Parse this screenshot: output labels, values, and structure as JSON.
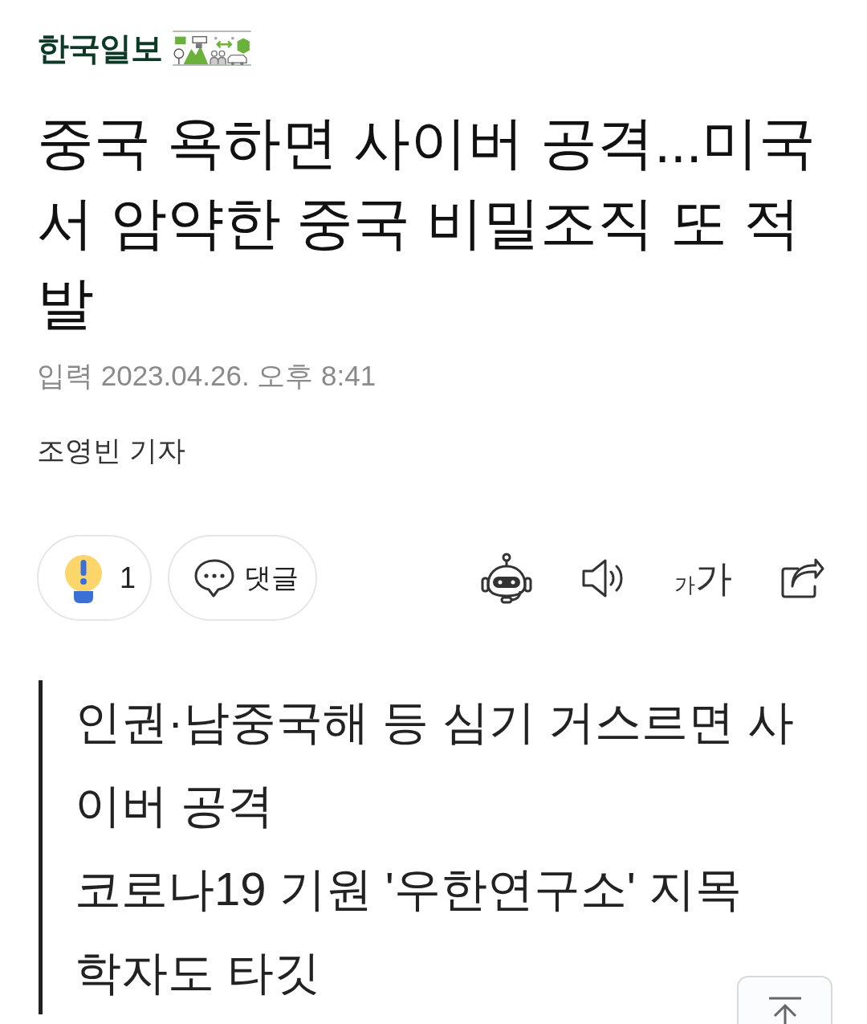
{
  "logo": {
    "text": "한국일보"
  },
  "headline": "중국 욕하면 사이버 공격...미국서 암약한 중국 비밀조직 또 적발",
  "published": "입력 2023.04.26. 오후 8:41",
  "byline": "조영빈 기자",
  "actions": [
    {
      "kind": "reaction",
      "label": "1"
    },
    {
      "kind": "comment",
      "label": "댓글"
    }
  ],
  "tools": [
    {
      "kind": "summary"
    },
    {
      "kind": "listen"
    },
    {
      "kind": "font_size",
      "small": "가",
      "large": "가"
    },
    {
      "kind": "share"
    }
  ],
  "summary": [
    "인권·남중국해 등 심기 거스르면 사이버 공격",
    "코로나19 기원 '우한연구소' 지목 학자도 타깃"
  ]
}
